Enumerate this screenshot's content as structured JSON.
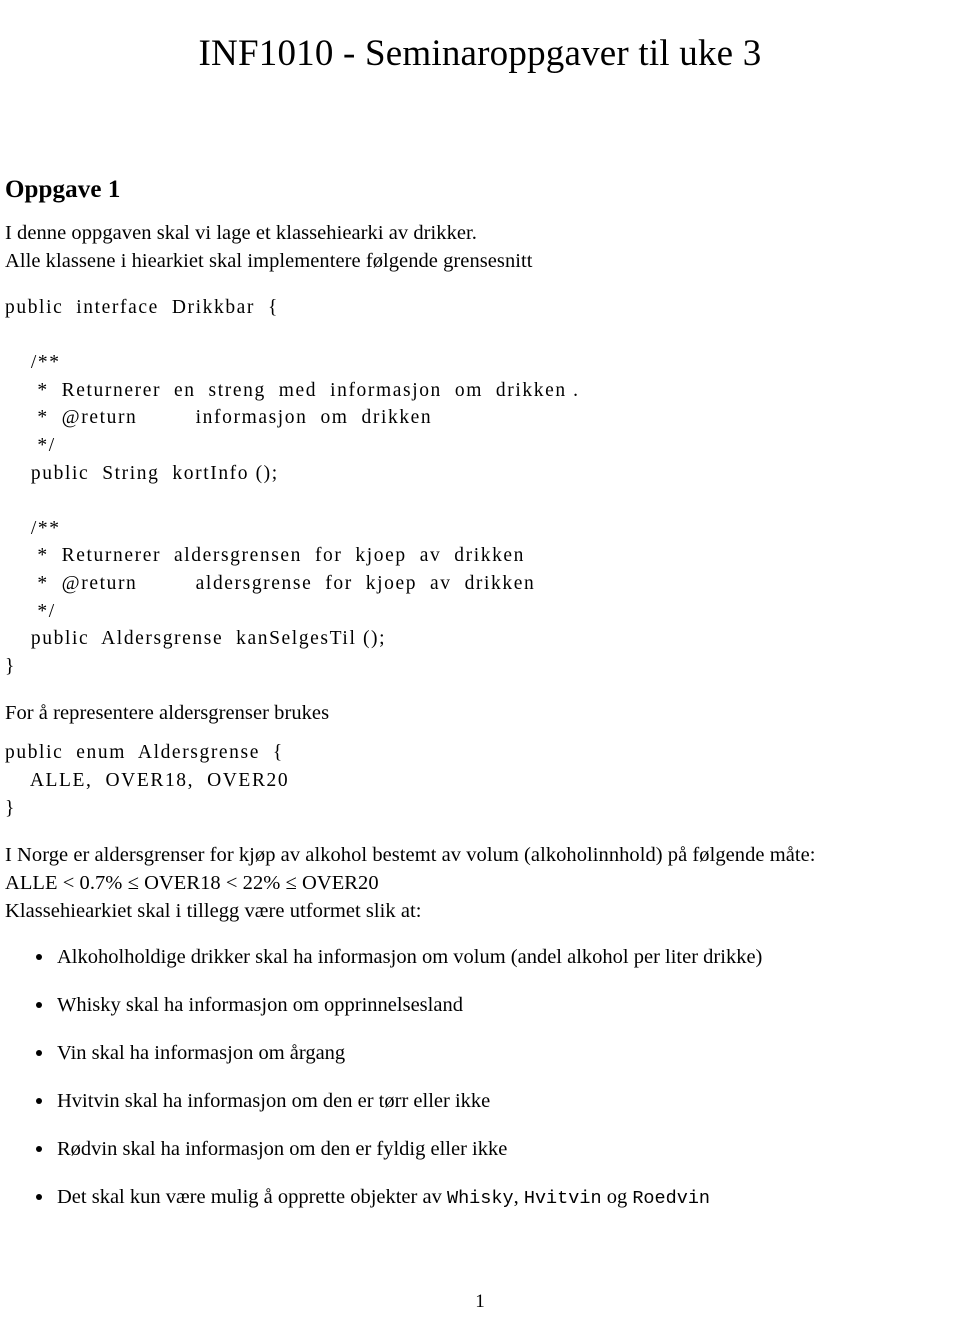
{
  "document": {
    "title": "INF1010 - Seminaroppgaver til uke 3",
    "page_number": "1"
  },
  "section": {
    "heading": "Oppgave 1",
    "intro_line_1": "I denne oppgaven skal vi lage et klassehiearki av drikker.",
    "intro_line_2": "Alle klassene i hiearkiet skal implementere følgende grensesnitt"
  },
  "code_interface": {
    "lines": [
      "public  interface  Drikkbar  {",
      "",
      "    /**",
      "     *  Returnerer  en  streng  med  informasjon  om  drikken .",
      "     *  @return         informasjon  om  drikken",
      "     */",
      "    public  String  kortInfo ();",
      "",
      "    /**",
      "     *  Returnerer  aldersgrensen  for  kjoep  av  drikken",
      "     *  @return         aldersgrense  for  kjoep  av  drikken",
      "     */",
      "    public  Aldersgrense  kanSelgesTil ();",
      "}"
    ]
  },
  "enum_intro": "For å representere aldersgrenser brukes",
  "code_enum": {
    "lines": [
      "public  enum  Aldersgrense  {",
      "    ALLE,  OVER18,  OVER20",
      "}"
    ]
  },
  "rules": {
    "line_1": "I Norge er aldersgrenser for kjøp av alkohol bestemt av volum (alkoholinnhold) på følgende måte:",
    "line_2": "ALLE < 0.7% ≤ OVER18 < 22% ≤ OVER20",
    "line_3": "Klassehiearkiet skal i tillegg være utformet slik at:"
  },
  "bullets": [
    {
      "text": "Alkoholholdige drikker skal ha informasjon om volum (andel alkohol per liter drikke)"
    },
    {
      "text": "Whisky skal ha informasjon om opprinnelsesland"
    },
    {
      "text": "Vin skal ha informasjon om årgang"
    },
    {
      "text": "Hvitvin skal ha informasjon om den er tørr eller ikke"
    },
    {
      "text": "Rødvin skal ha informasjon om den er fyldig eller ikke"
    },
    {
      "prefix": "Det skal kun være mulig å opprette objekter av ",
      "code_1": "Whisky",
      "mid_1": ", ",
      "code_2": "Hvitvin",
      "mid_2": " og ",
      "code_3": "Roedvin"
    }
  ]
}
